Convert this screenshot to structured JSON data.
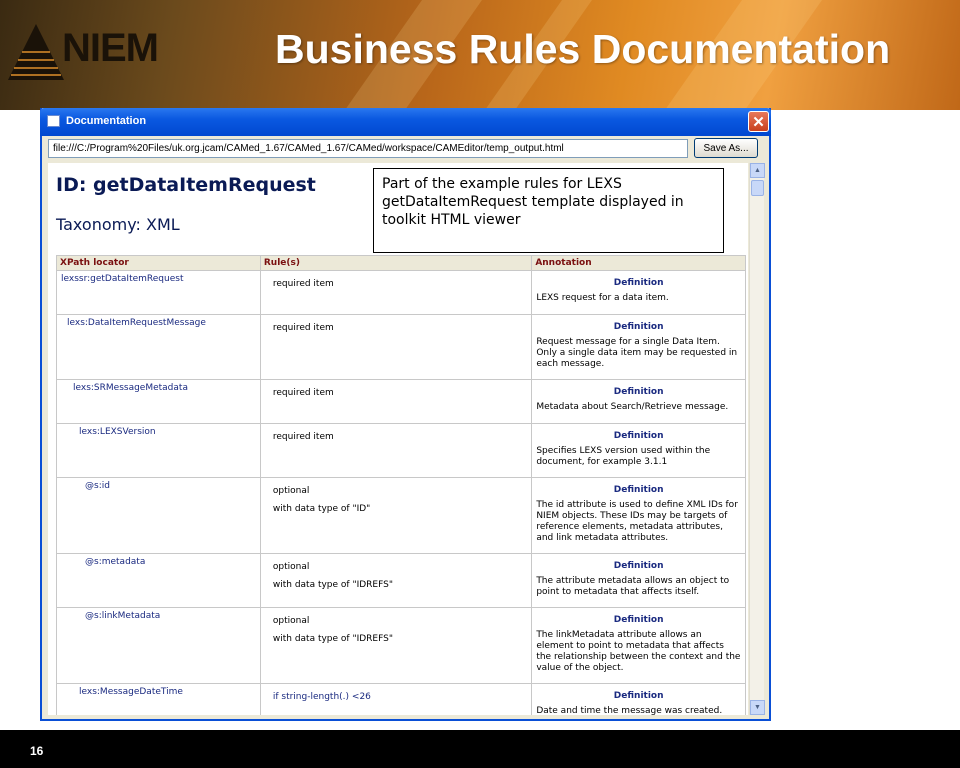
{
  "slide": {
    "logo_text": "NIEM",
    "title": "Business Rules Documentation",
    "page_number": "16"
  },
  "window": {
    "title": "Documentation",
    "close_symbol": "✕",
    "url": "file:///C:/Program%20Files/uk.org.jcam/CAMed_1.67/CAMed_1.67/CAMed/workspace/CAMEditor/temp_output.html",
    "save_label": "Save As..."
  },
  "document": {
    "id_line": "ID: getDataItemRequest",
    "taxonomy_line": "Taxonomy: XML",
    "columns": [
      "XPath locator",
      "Rule(s)",
      "Annotation"
    ],
    "rows": [
      {
        "xpath": "lexssr:getDataItemRequest",
        "indent": 0,
        "rules": [
          "required item"
        ],
        "annotation_head": "Definition",
        "annotation": "LEXS request for a data item."
      },
      {
        "xpath": "lexs:DataItemRequestMessage",
        "indent": 1,
        "rules": [
          "required item"
        ],
        "annotation_head": "Definition",
        "annotation": "Request message for a single Data Item. Only a single data item may be requested in each message."
      },
      {
        "xpath": "lexs:SRMessageMetadata",
        "indent": 2,
        "rules": [
          "required item"
        ],
        "annotation_head": "Definition",
        "annotation": "Metadata about Search/Retrieve message."
      },
      {
        "xpath": "lexs:LEXSVersion",
        "indent": 3,
        "rules": [
          "required item"
        ],
        "annotation_head": "Definition",
        "annotation": "Specifies LEXS version used within the document, for example 3.1.1"
      },
      {
        "xpath": "@s:id",
        "indent": 4,
        "rules": [
          "optional",
          "with data type of \"ID\""
        ],
        "annotation_head": "Definition",
        "annotation": "The id attribute is used to define XML IDs for NIEM objects. These IDs may be targets of reference elements, metadata attributes, and link metadata attributes."
      },
      {
        "xpath": "@s:metadata",
        "indent": 4,
        "rules": [
          "optional",
          "with data type of \"IDREFS\""
        ],
        "annotation_head": "Definition",
        "annotation": "The attribute metadata allows an object to point to metadata that affects itself."
      },
      {
        "xpath": "@s:linkMetadata",
        "indent": 4,
        "rules": [
          "optional",
          "with data type of \"IDREFS\""
        ],
        "annotation_head": "Definition",
        "annotation": "The linkMetadata attribute allows an element to point to metadata that affects the relationship between the context and the value of the object."
      },
      {
        "xpath": "lexs:MessageDateTime",
        "indent": 3,
        "rules": [
          "if string-length(.) <26"
        ],
        "annotation_head": "Definition",
        "annotation": "Date and time the message was created."
      }
    ]
  },
  "callout": {
    "text": "Part of the example rules for LEXS getDataItemRequest template displayed in toolkit HTML viewer"
  }
}
